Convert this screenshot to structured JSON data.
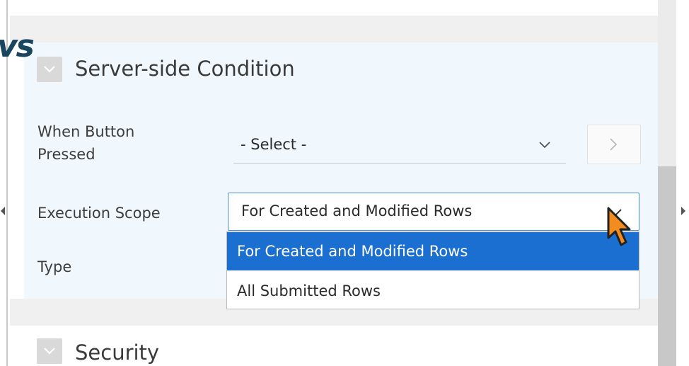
{
  "header": {
    "cut_title": "vs"
  },
  "server_side_condition": {
    "title": "Server-side Condition",
    "when_button_pressed": {
      "label_line1": "When Button",
      "label_line2": "Pressed",
      "value": "- Select -"
    },
    "execution_scope": {
      "label": "Execution Scope",
      "value": "For Created and Modified Rows",
      "options": [
        "For Created and Modified Rows",
        "All Submitted Rows"
      ],
      "selected_index": 0
    },
    "type": {
      "label": "Type"
    }
  },
  "security": {
    "title": "Security"
  },
  "icons": {
    "collapse": "chevron-down-icon",
    "go": "chevron-right-icon",
    "cursor": "arrow-cursor-icon"
  },
  "colors": {
    "accent": "#1b6fd1",
    "region_bg": "#f1f8fd",
    "focus_border": "#4a90d9",
    "cursor_fill": "#f28c1e"
  }
}
